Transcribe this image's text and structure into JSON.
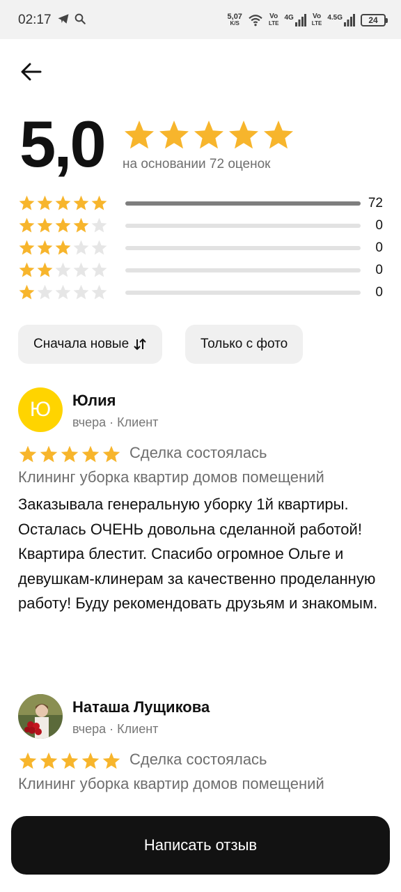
{
  "status_bar": {
    "time": "02:17",
    "net_speed_value": "5,07",
    "net_speed_unit": "K/S",
    "sim1_top": "Vo",
    "sim1_bottom": "LTE",
    "sim1_type": "4G",
    "sim2_top": "Vo",
    "sim2_bottom": "LTE",
    "sim2_type": "4.5G",
    "battery": "24"
  },
  "summary": {
    "rating": "5,0",
    "stars": 5,
    "based_on": "на основании 72 оценок"
  },
  "histogram": [
    {
      "stars": 5,
      "count": "72",
      "fraction": 1.0
    },
    {
      "stars": 4,
      "count": "0",
      "fraction": 0
    },
    {
      "stars": 3,
      "count": "0",
      "fraction": 0
    },
    {
      "stars": 2,
      "count": "0",
      "fraction": 0
    },
    {
      "stars": 1,
      "count": "0",
      "fraction": 0
    }
  ],
  "filters": {
    "sort_label": "Сначала новые",
    "photo_label": "Только с фото"
  },
  "reviews": [
    {
      "avatar_letter": "Ю",
      "name": "Юлия",
      "meta": "вчера · Клиент",
      "stars": 5,
      "deal": "Сделка состоялась",
      "service": "Клининг уборка квартир домов помещений",
      "text": "Заказывала генеральную уборку 1й квартиры. Осталась ОЧЕНЬ довольна сделанной работой! Квартира блестит. Спасибо огромное Ольге и девушкам-клинерам за качественно проделанную работу! Буду рекомендовать друзьям и знакомым."
    },
    {
      "avatar_letter": "",
      "name": "Наташа Лущикова",
      "meta": "вчера · Клиент",
      "stars": 5,
      "deal": "Сделка состоялась",
      "service": "Клининг уборка квартир домов помещений",
      "text": ""
    }
  ],
  "write_review_label": "Написать отзыв",
  "colors": {
    "star_filled": "#f7b52c",
    "star_empty": "#e6e6e6",
    "avatar_yellow": "#ffd400",
    "button_bg": "#121212"
  }
}
